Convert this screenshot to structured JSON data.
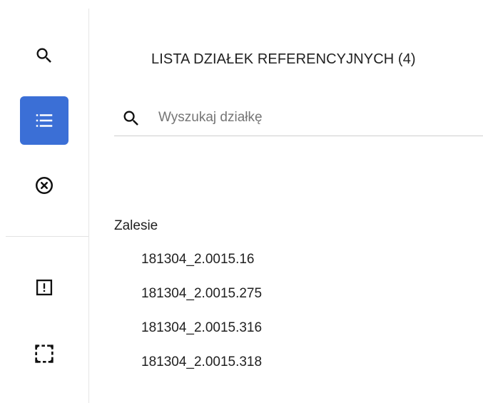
{
  "sidebar": {
    "items": [
      {
        "icon": "search-icon",
        "active": false
      },
      {
        "icon": "list-icon",
        "active": true
      },
      {
        "icon": "clear-circle-icon",
        "active": false
      },
      {
        "icon": "alert-box-icon",
        "active": false
      },
      {
        "icon": "selection-rectangle-icon",
        "active": false
      }
    ],
    "accent_color": "#3b6fd6"
  },
  "panel": {
    "title": "LISTA DZIAŁEK REFERENCYJNYCH (4)"
  },
  "search": {
    "placeholder": "Wyszukaj działkę",
    "value": ""
  },
  "groups": [
    {
      "label": "Zalesie",
      "parcels": [
        "181304_2.0015.16",
        "181304_2.0015.275",
        "181304_2.0015.316",
        "181304_2.0015.318"
      ]
    }
  ]
}
